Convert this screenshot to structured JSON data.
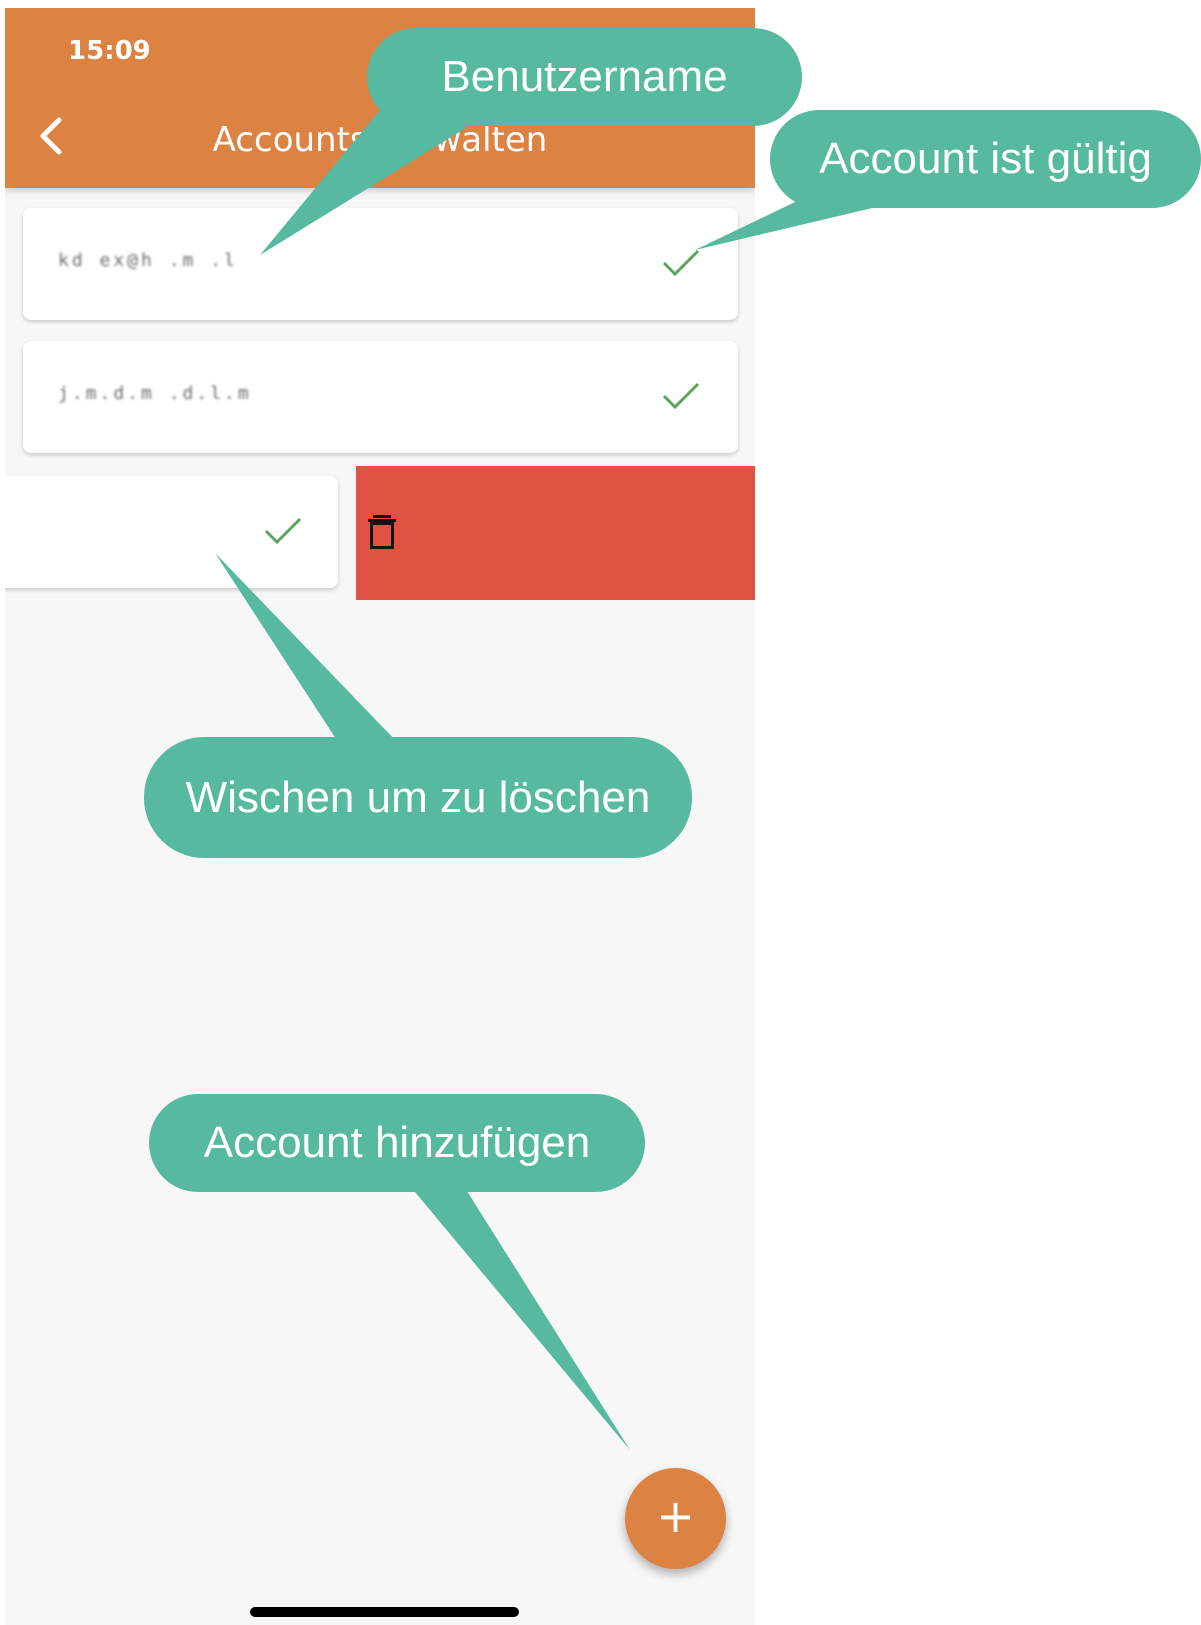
{
  "status_bar": {
    "time": "15:09"
  },
  "app_bar": {
    "title": "Accounts verwalten",
    "back_icon": "chevron-left-icon",
    "color": "#dc8242"
  },
  "accounts": [
    {
      "username": "kd ex@h .m .l",
      "status_icon": "check-icon"
    },
    {
      "username": "j.m.d.m  .d.l.m",
      "status_icon": "check-icon"
    },
    {
      "username": "",
      "status_icon": "check-icon"
    }
  ],
  "swipe_action": {
    "icon": "trash-icon",
    "color": "#e05242"
  },
  "fab": {
    "label": "+",
    "icon": "plus-icon"
  },
  "callouts": {
    "username": "Benutzername",
    "valid": "Account ist gültig",
    "swipe": "Wischen um zu löschen",
    "add": "Account hinzufügen",
    "color": "#56b9a0"
  }
}
